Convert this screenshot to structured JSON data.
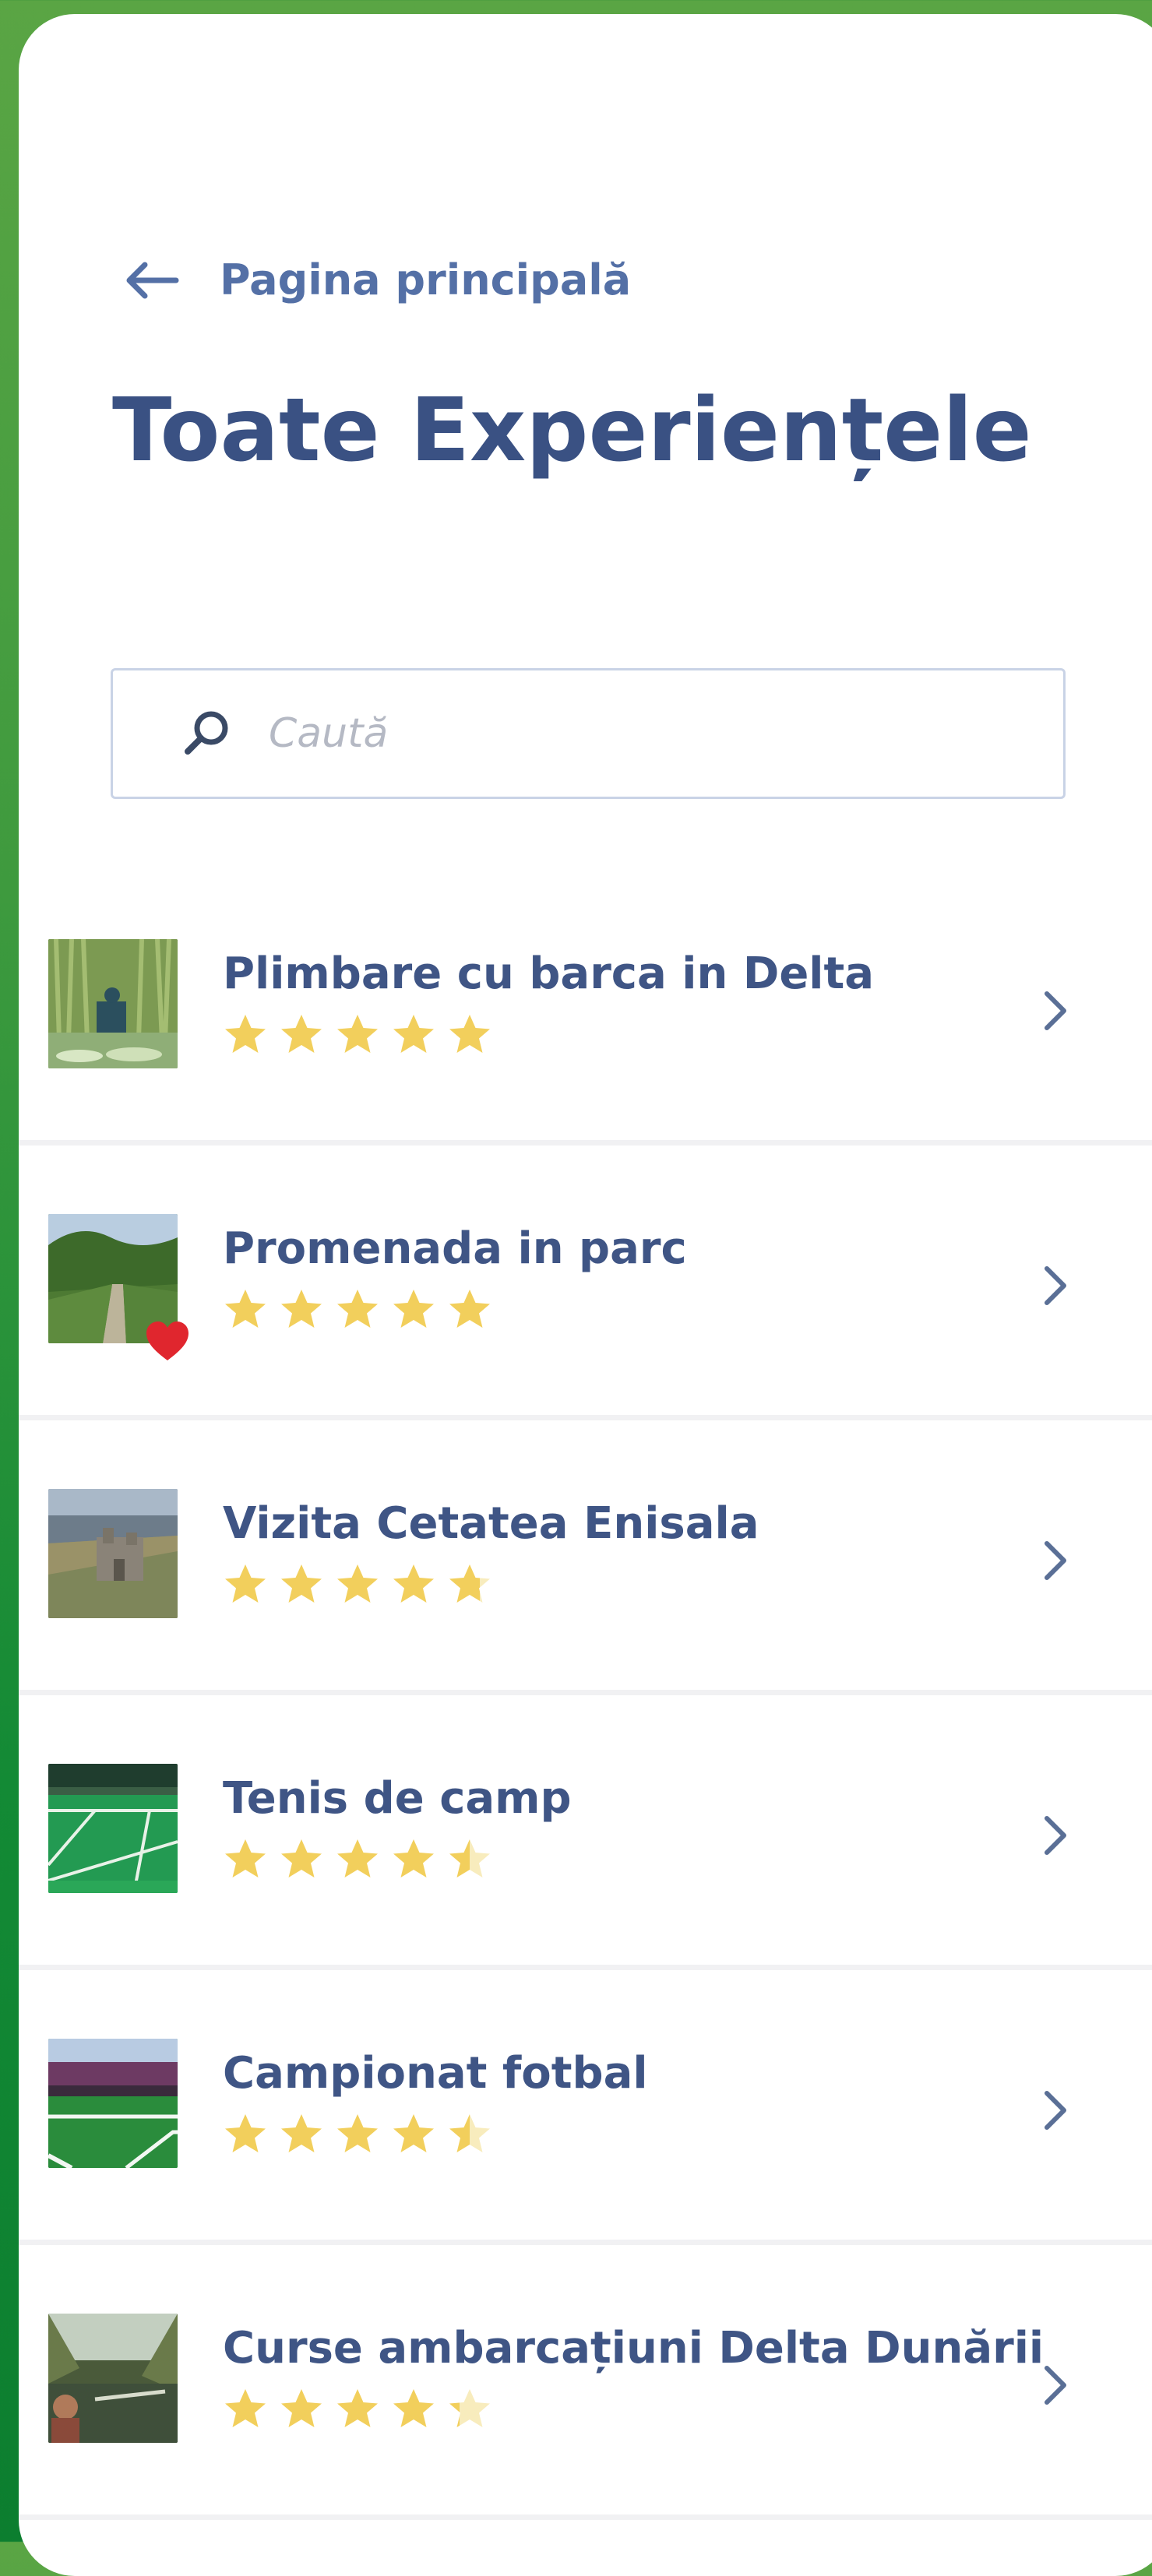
{
  "header": {
    "back_label": "Pagina principală",
    "title": "Toate Experiențele"
  },
  "search": {
    "placeholder": "Caută",
    "icon": "search-icon"
  },
  "colors": {
    "title": "#3a5183",
    "star": "#f2cf5c",
    "star_empty": "#f8ecbd",
    "heart": "#e0262e",
    "background_green": "#138a35"
  },
  "experiences": [
    {
      "title": "Plimbare cu barca in Delta",
      "rating": 5,
      "favorite": false,
      "thumb": "reeds-boat"
    },
    {
      "title": "Promenada in parc",
      "rating": 5,
      "favorite": true,
      "thumb": "park-path"
    },
    {
      "title": "Vizita Cetatea Enisala",
      "rating": 4.75,
      "favorite": false,
      "thumb": "fortress"
    },
    {
      "title": "Tenis de camp",
      "rating": 4.5,
      "favorite": false,
      "thumb": "tennis-court"
    },
    {
      "title": "Campionat fotbal",
      "rating": 4.5,
      "favorite": false,
      "thumb": "football-stadium"
    },
    {
      "title": "Curse ambarcațiuni Delta Dunării",
      "rating": 4.25,
      "favorite": false,
      "thumb": "delta-boat"
    }
  ]
}
